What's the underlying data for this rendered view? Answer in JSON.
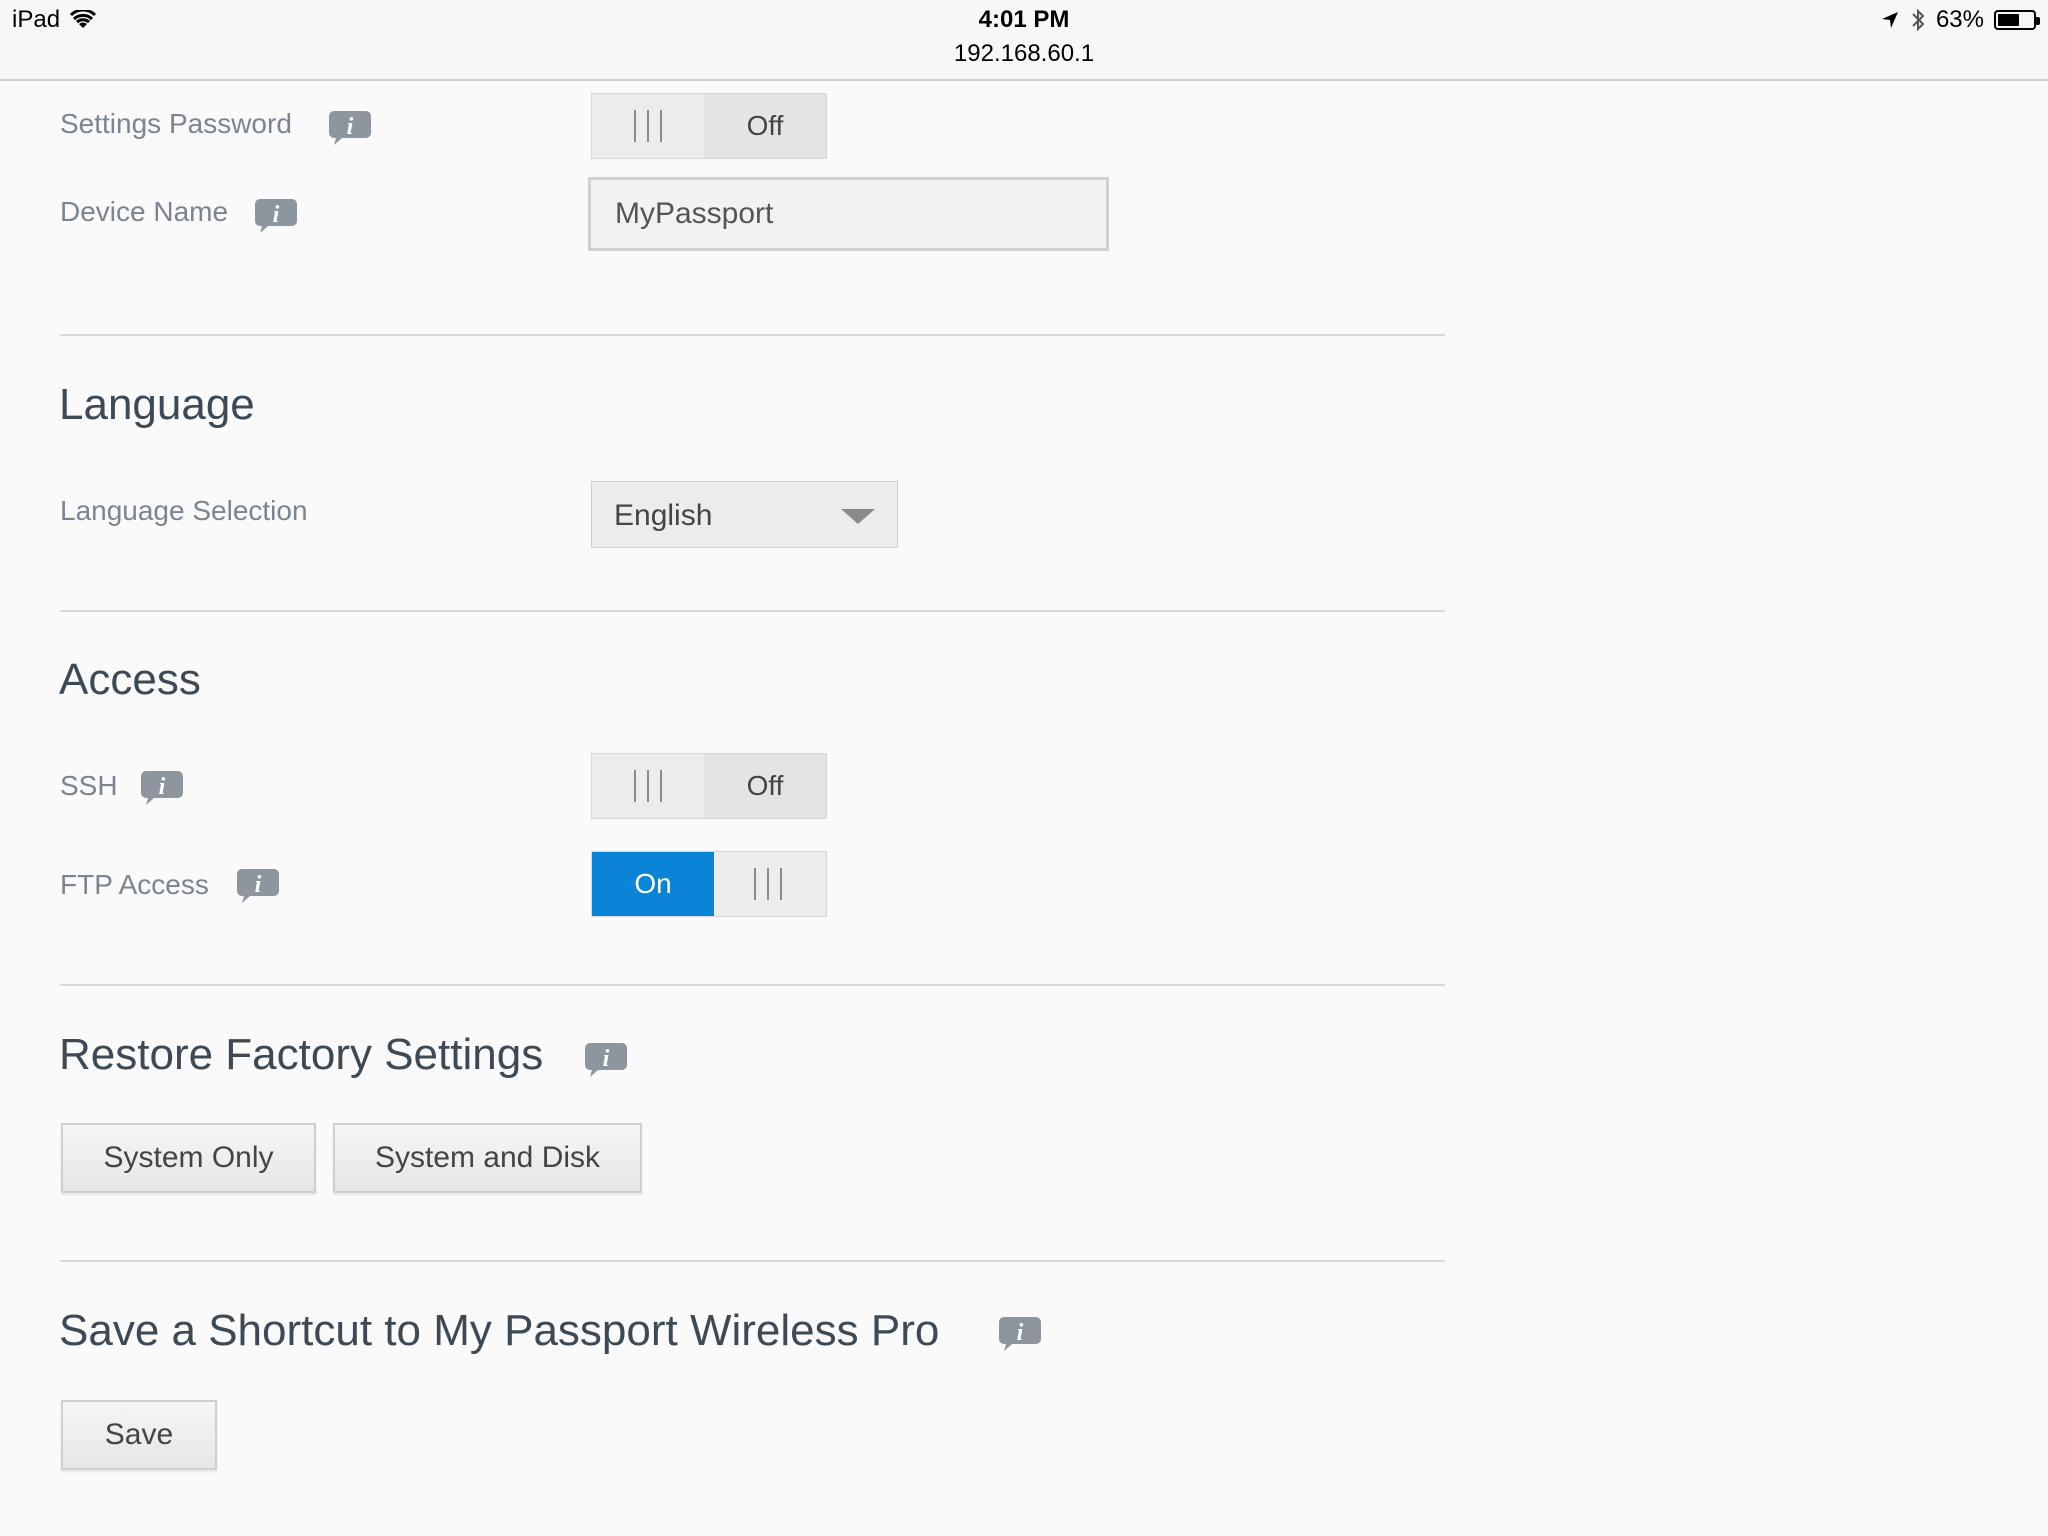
{
  "statusbar": {
    "device": "iPad",
    "time": "4:01 PM",
    "url": "192.168.60.1",
    "battery": "63%",
    "battery_level": 0.63
  },
  "general": {
    "settings_password_label": "Settings Password",
    "settings_password_state": "Off",
    "device_name_label": "Device Name",
    "device_name_value": "MyPassport"
  },
  "language": {
    "heading": "Language",
    "selection_label": "Language Selection",
    "selected": "English"
  },
  "access": {
    "heading": "Access",
    "ssh_label": "SSH",
    "ssh_state": "Off",
    "ftp_label": "FTP Access",
    "ftp_state": "On"
  },
  "restore": {
    "heading": "Restore Factory Settings",
    "system_only": "System Only",
    "system_and_disk": "System and Disk"
  },
  "shortcut": {
    "heading": "Save a Shortcut to My Passport Wireless Pro",
    "save": "Save"
  },
  "icons": {
    "info": "info-icon",
    "wifi": "wifi-icon",
    "location": "location-arrow-icon",
    "bluetooth": "bluetooth-icon",
    "battery": "battery-icon",
    "dropdown": "chevron-down-icon"
  },
  "colors": {
    "accent": "#0a84d6",
    "label": "#7a8591",
    "heading": "#3d4a55",
    "info_icon": "#8d969e"
  }
}
